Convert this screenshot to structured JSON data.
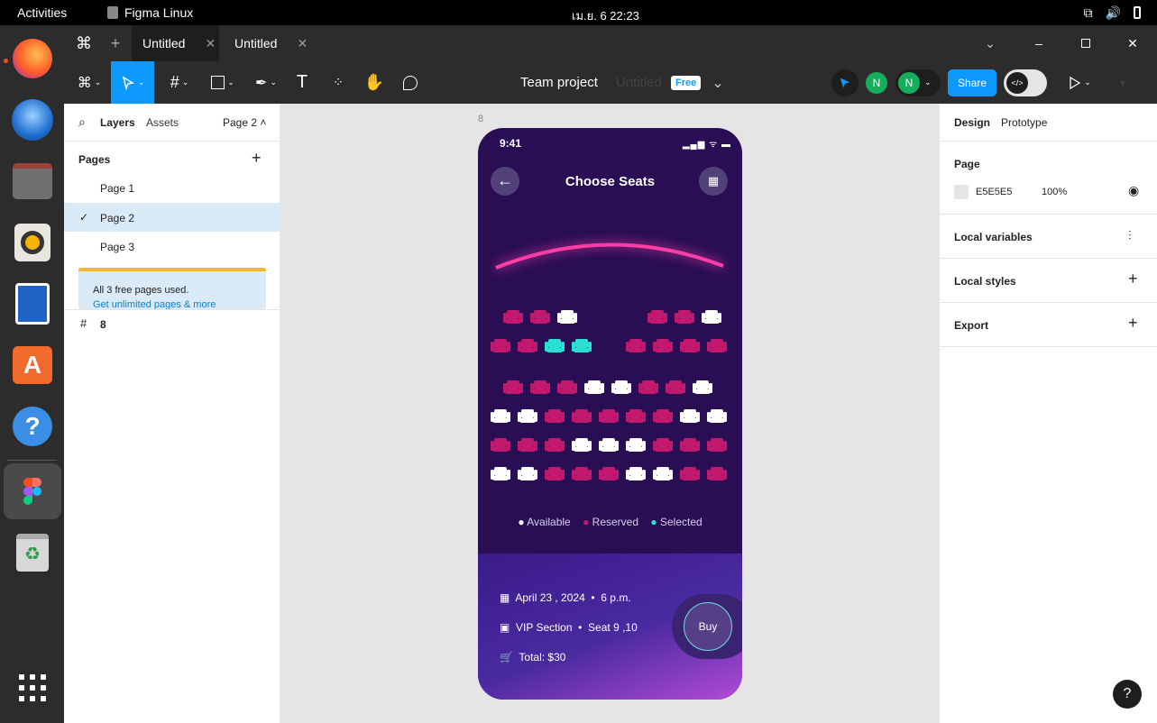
{
  "system": {
    "activities": "Activities",
    "app_name": "Figma Linux",
    "clock": "เม.ย. 6  22:23"
  },
  "tabs": [
    {
      "label": "Untitled"
    },
    {
      "label": "Untitled"
    }
  ],
  "toolbar": {
    "project": "Team project",
    "file_name": "Untitled",
    "plan_badge": "Free",
    "share_label": "Share",
    "avatar_1": "N",
    "avatar_2": "N"
  },
  "left": {
    "tab_layers": "Layers",
    "tab_assets": "Assets",
    "page_selector": "Page 2",
    "pages_heading": "Pages",
    "pages": [
      "Page 1",
      "Page 2",
      "Page 3"
    ],
    "notice": "All 3 free pages used.",
    "notice_link": "Get unlimited pages & more",
    "layer": "8"
  },
  "canvas": {
    "frame_label": "8"
  },
  "phone": {
    "time": "9:41",
    "title": "Choose Seats",
    "legend": [
      "Available",
      "Reserved",
      "Selected"
    ],
    "date": "April 23 , 2024",
    "showtime": "6 p.m.",
    "section": "VIP Section",
    "seats": "Seat 9 ,10",
    "total": "Total: $30",
    "buy": "Buy",
    "colors": {
      "available": "#ffffff",
      "reserved": "#c2186e",
      "selected": "#29e0d2"
    },
    "seat_rows": [
      [
        "_",
        "R",
        "R",
        "A",
        "_",
        "_",
        "_",
        "R",
        "R",
        "A",
        "_"
      ],
      [
        "R",
        "R",
        "S",
        "S",
        "_",
        "_",
        "R",
        "R",
        "R",
        "R"
      ],
      [
        "_",
        "R",
        "R",
        "R",
        "A",
        "A",
        "R",
        "R",
        "A",
        "_"
      ],
      [
        "A",
        "A",
        "R",
        "R",
        "R",
        "R",
        "R",
        "A",
        "A"
      ],
      [
        "R",
        "R",
        "R",
        "A",
        "A",
        "A",
        "R",
        "R",
        "R"
      ],
      [
        "A",
        "A",
        "R",
        "R",
        "R",
        "A",
        "A",
        "R",
        "R"
      ]
    ]
  },
  "right": {
    "tab_design": "Design",
    "tab_prototype": "Prototype",
    "page_heading": "Page",
    "bg_hex": "E5E5E5",
    "bg_opacity": "100%",
    "local_variables": "Local variables",
    "local_styles": "Local styles",
    "export": "Export"
  },
  "help": "?"
}
